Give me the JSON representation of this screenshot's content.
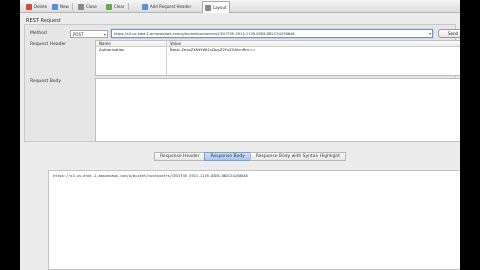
{
  "toolbar": {
    "items": [
      {
        "label": "Delete",
        "color": "#d24b3a"
      },
      {
        "label": "New",
        "color": "#5b8fd6"
      },
      {
        "label": "Close",
        "color": "#8a8a8a"
      },
      {
        "label": "Clear",
        "color": "#6aa84f"
      },
      {
        "label": "Add Request Header",
        "color": "#5b8fd6"
      },
      {
        "label": "Layout",
        "color": "#888888"
      }
    ]
  },
  "section_title": "REST Request",
  "request": {
    "method_label": "Method",
    "method_value": "POST",
    "url": "https://s3.us-east-1.amazonaws.com/a/bucket/containers/CE07F5E-5913-1139-83E8-8B2C54258648",
    "send_label": "Send",
    "header_label": "Request Header",
    "body_label": "Request Body"
  },
  "headers_table": {
    "columns": [
      "Name",
      "Value"
    ],
    "rows": [
      {
        "name": "Authorization",
        "value": "Basic ZmlsZXNtYWt1cDpxZ2FuZGhlcnRm=="
      }
    ]
  },
  "response_tabs": [
    {
      "label": "Response Header",
      "selected": false
    },
    {
      "label": "Response Body",
      "selected": true
    },
    {
      "label": "Response Body with Syntax Highlight",
      "selected": false
    }
  ],
  "response_body": "https://s3.us-east-1.amazonaws.com/a/bucket/containers/CE07F5E-5913-1139-83E8-8B2C54258648"
}
